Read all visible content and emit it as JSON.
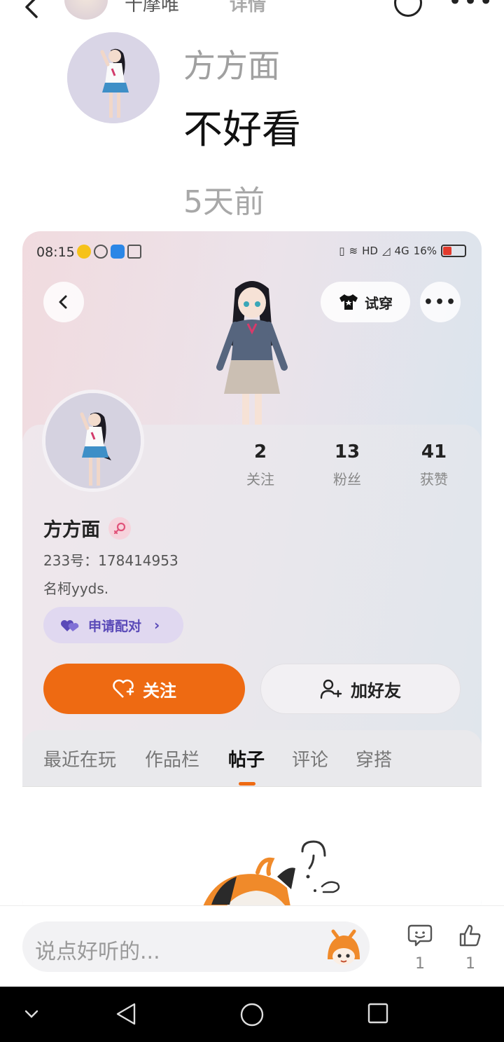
{
  "top_header": {
    "username": "十摩唯",
    "title": "详情"
  },
  "comment": {
    "author": "方方面",
    "text": "不好看",
    "time": "5天前"
  },
  "embedded_screenshot": {
    "status_bar": {
      "time": "08:15",
      "network": "HD",
      "signal": "4G",
      "battery": "16%"
    },
    "try_on_label": "试穿",
    "stats": [
      {
        "value": "2",
        "label": "关注"
      },
      {
        "value": "13",
        "label": "粉丝"
      },
      {
        "value": "41",
        "label": "获赞"
      }
    ],
    "profile": {
      "name": "方方面",
      "id_text": "233号：178414953",
      "bio": "名柯yyds."
    },
    "pair_label": "申请配对",
    "follow_label": "关注",
    "add_friend_label": "加好友",
    "tabs": [
      {
        "label": "最近在玩",
        "active": false
      },
      {
        "label": "作品栏",
        "active": false
      },
      {
        "label": "帖子",
        "active": true
      },
      {
        "label": "评论",
        "active": false
      },
      {
        "label": "穿搭",
        "active": false
      }
    ]
  },
  "bottom_bar": {
    "placeholder": "说点好听的...",
    "comment_count": "1",
    "like_count": "1"
  },
  "colors": {
    "accent": "#ee6a12",
    "pair_bg": "#e0d8f0",
    "pair_text": "#5a4ab8"
  }
}
